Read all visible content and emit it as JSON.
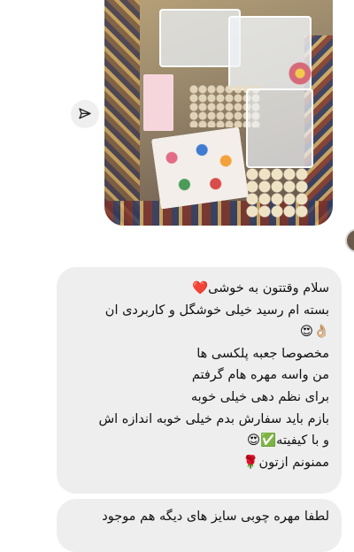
{
  "photo": {
    "alt": "product-photo"
  },
  "share_icon": "paper-plane-icon",
  "messages": [
    {
      "lines": [
        "سلام وقتتون به خوشی❤️",
        "بسته ام رسید خیلی خوشگل و کاربردی ان",
        "👌🏼😍",
        "مخصوصا جعبه پلکسی ها",
        "من واسه مهره هام گرفتم",
        "برای نظم دهی خیلی خوبه",
        "بازم باید سفارش بدم خیلی خوبه اندازه اش",
        "و با کیفیته✅😍",
        "ممنونم ازتون🌹"
      ]
    },
    {
      "lines": [
        "لطفا مهره چوبی سایز های دیگه هم موجود"
      ]
    }
  ]
}
